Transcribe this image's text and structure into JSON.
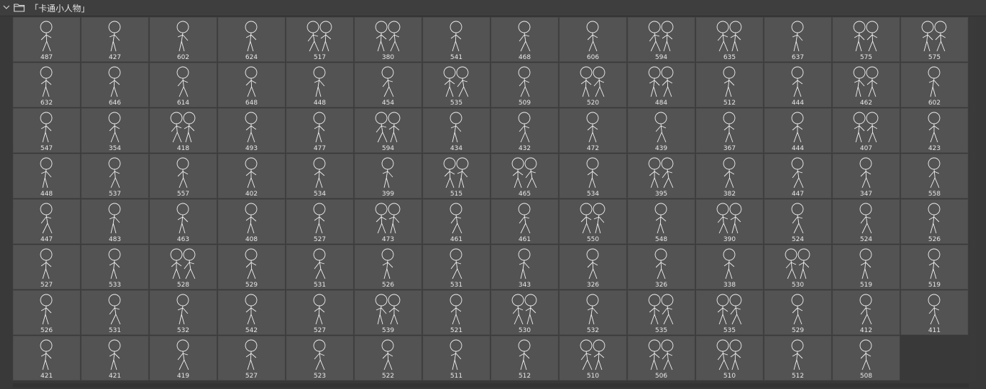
{
  "header": {
    "title": "「卡通小人物」",
    "chevron_icon": "chevron-down-icon",
    "folder_icon": "folder-icon"
  },
  "brushes": [
    "487",
    "427",
    "602",
    "624",
    "517",
    "380",
    "541",
    "468",
    "606",
    "594",
    "635",
    "637",
    "575",
    "575",
    "632",
    "646",
    "614",
    "648",
    "448",
    "454",
    "535",
    "509",
    "520",
    "484",
    "512",
    "444",
    "462",
    "602",
    "547",
    "354",
    "418",
    "493",
    "477",
    "594",
    "434",
    "432",
    "472",
    "439",
    "367",
    "444",
    "407",
    "423",
    "448",
    "537",
    "557",
    "402",
    "534",
    "399",
    "515",
    "465",
    "534",
    "395",
    "382",
    "447",
    "347",
    "558",
    "447",
    "483",
    "463",
    "408",
    "527",
    "473",
    "461",
    "461",
    "550",
    "548",
    "390",
    "524",
    "524",
    "526",
    "527",
    "533",
    "528",
    "529",
    "531",
    "526",
    "531",
    "343",
    "326",
    "326",
    "338",
    "530",
    "519",
    "519",
    "526",
    "531",
    "532",
    "542",
    "527",
    "539",
    "521",
    "530",
    "532",
    "535",
    "535",
    "529",
    "412",
    "411",
    "421",
    "421",
    "419",
    "527",
    "523",
    "522",
    "511",
    "512",
    "510",
    "506",
    "510",
    "512",
    "508"
  ],
  "colors": {
    "panel_bg": "#393939",
    "tile_bg": "#535353",
    "stroke": "#f2f2f2",
    "text": "#e8e8e8"
  }
}
